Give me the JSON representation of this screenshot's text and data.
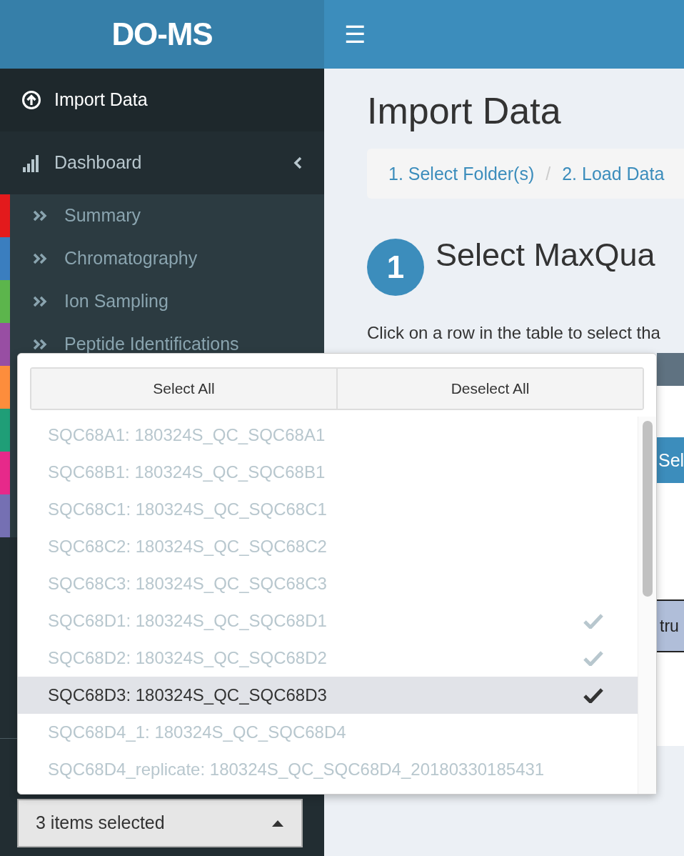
{
  "header": {
    "logo": "DO-MS",
    "menu_toggle": "☰"
  },
  "sidebar": {
    "items": [
      {
        "label": "Import Data",
        "selected": true
      },
      {
        "label": "Dashboard",
        "selected": false,
        "expanded": true
      }
    ],
    "subitems": [
      {
        "label": "Summary",
        "color": "#e31a1c"
      },
      {
        "label": "Chromatography",
        "color": "#3a7ebf"
      },
      {
        "label": "Ion Sampling",
        "color": "#5cb54c"
      },
      {
        "label": "Peptide Identifications",
        "color": "#984ea3"
      },
      {
        "color": "#fd8d3c"
      },
      {
        "color": "#1f9e77"
      },
      {
        "color": "#e7298a"
      },
      {
        "color": "#7570b3"
      }
    ],
    "select_button": {
      "value": "3 items selected",
      "expanded": true
    }
  },
  "main": {
    "title": "Import Data",
    "breadcrumb_separator": "/",
    "breadcrumb": [
      {
        "label": "1. Select Folder(s)"
      },
      {
        "label": "2. Load Data"
      }
    ],
    "step": {
      "number": "1",
      "title": "Select MaxQua"
    },
    "instruction": "Click on a row in the table to select tha",
    "button": "Sel",
    "table_cell": "tru"
  },
  "dropdown": {
    "actions": [
      "Select All",
      "Deselect All"
    ],
    "options": [
      {
        "label": "SQC68A1: 180324S_QC_SQC68A1",
        "disabled": true,
        "checked": false,
        "highlighted": false
      },
      {
        "label": "SQC68B1: 180324S_QC_SQC68B1",
        "disabled": true,
        "checked": false,
        "highlighted": false
      },
      {
        "label": "SQC68C1: 180324S_QC_SQC68C1",
        "disabled": true,
        "checked": false,
        "highlighted": false
      },
      {
        "label": "SQC68C2: 180324S_QC_SQC68C2",
        "disabled": true,
        "checked": false,
        "highlighted": false
      },
      {
        "label": "SQC68C3: 180324S_QC_SQC68C3",
        "disabled": true,
        "checked": false,
        "highlighted": false
      },
      {
        "label": "SQC68D1: 180324S_QC_SQC68D1",
        "disabled": true,
        "checked": true,
        "highlighted": false
      },
      {
        "label": "SQC68D2: 180324S_QC_SQC68D2",
        "disabled": true,
        "checked": true,
        "highlighted": false
      },
      {
        "label": "SQC68D3: 180324S_QC_SQC68D3",
        "disabled": false,
        "checked": true,
        "highlighted": true
      },
      {
        "label": "SQC68D4_1: 180324S_QC_SQC68D4",
        "disabled": true,
        "checked": false,
        "highlighted": false
      },
      {
        "label": "SQC68D4_replicate: 180324S_QC_SQC68D4_20180330185431",
        "disabled": true,
        "checked": false,
        "highlighted": false
      }
    ]
  }
}
